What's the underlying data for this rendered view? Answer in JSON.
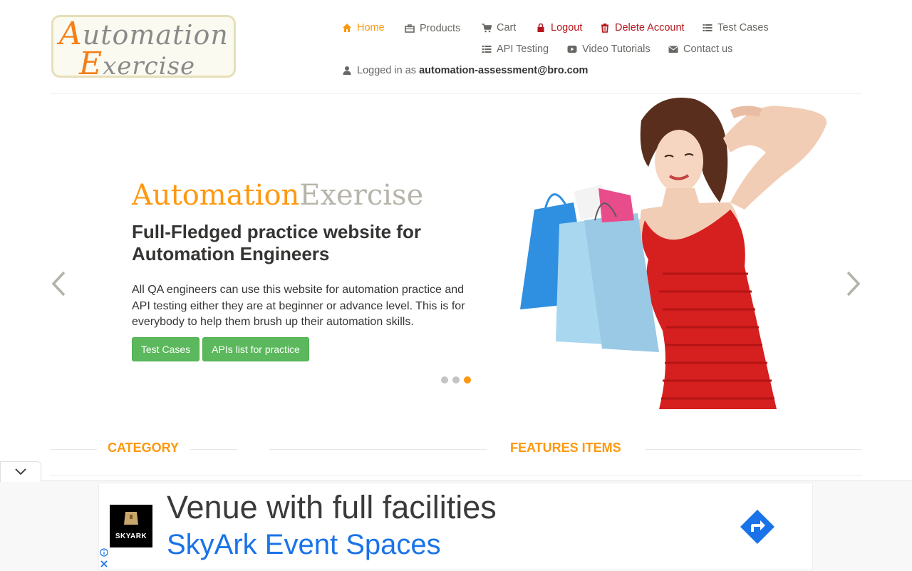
{
  "logo": {
    "line1_cap": "A",
    "line1_rest": "utomation",
    "line2_cap": "E",
    "line2_rest": "xercise"
  },
  "nav": {
    "home": "Home",
    "products": "Products",
    "cart": "Cart",
    "logout": "Logout",
    "delete_account": "Delete Account",
    "test_cases": "Test Cases",
    "api_testing": "API Testing",
    "video_tutorials": "Video Tutorials",
    "contact_us": "Contact us",
    "logged_in_prefix": "Logged in as",
    "logged_in_user": "automation-assessment@bro.com"
  },
  "slider": {
    "brand_part1": "Automation",
    "brand_part2": "Exercise",
    "headline": "Full-Fledged practice website for Automation Engineers",
    "description": "All QA engineers can use this website for automation practice and API testing either they are at beginner or advance level. This is for everybody to help them brush up their automation skills.",
    "btn_test_cases": "Test Cases",
    "btn_apis": "APIs list for practice",
    "active_slide": 3,
    "slide_count": 3
  },
  "sections": {
    "category": "CATEGORY",
    "features": "FEATURES ITEMS"
  },
  "ad": {
    "logo_text": "SKYARK",
    "headline": "Venue with full facilities",
    "subline": "SkyArk Event Spaces"
  },
  "colors": {
    "accent": "#FE980F",
    "button_green": "#5cb85c",
    "danger": "#b5161d",
    "ad_blue": "#1a73e8"
  }
}
